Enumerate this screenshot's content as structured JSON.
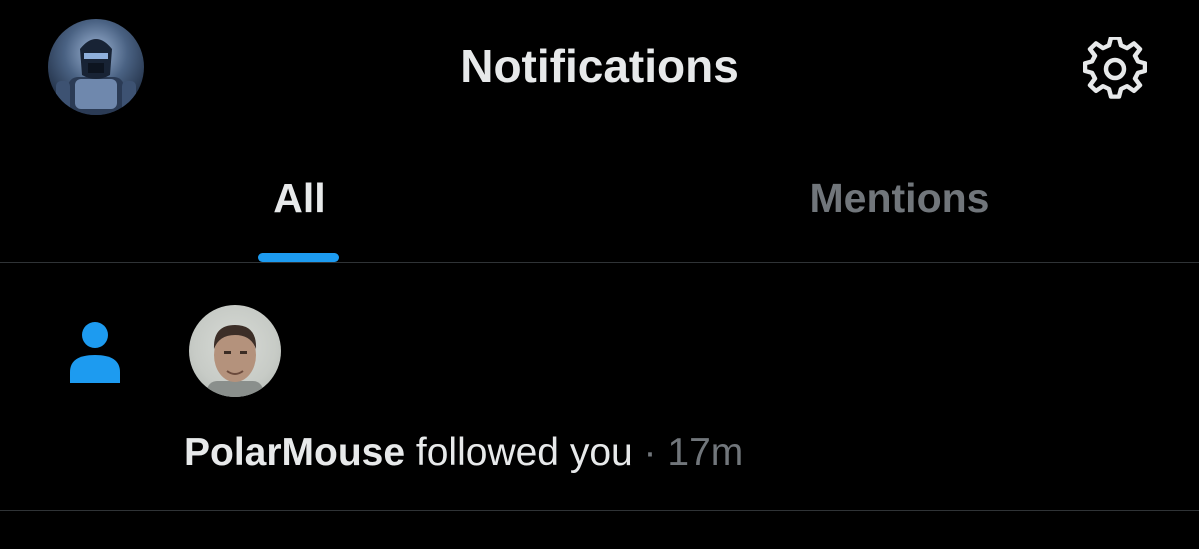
{
  "header": {
    "title": "Notifications",
    "profile_avatar_icon": "profile-avatar-icon",
    "settings_icon": "gear-icon"
  },
  "tabs": [
    {
      "label": "All",
      "active": true
    },
    {
      "label": "Mentions",
      "active": false
    }
  ],
  "notifications": [
    {
      "type_icon": "person-icon",
      "user": "PolarMouse",
      "action": " followed you ",
      "separator": "·",
      "time": " 17m"
    }
  ],
  "colors": {
    "accent": "#1d9bf0",
    "background": "#000000",
    "text_primary": "#e7e9ea",
    "text_secondary": "#71767b",
    "divider": "#2f3336"
  }
}
